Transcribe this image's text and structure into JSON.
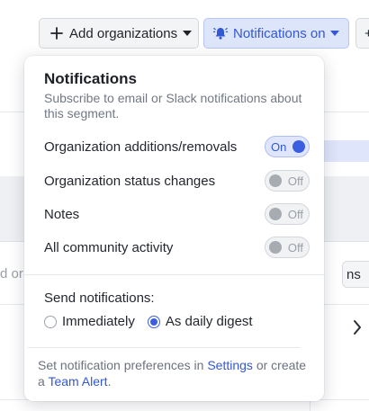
{
  "toolbar": {
    "add_label": "Add organizations",
    "notif_label": "Notifications on",
    "edge_label": "+"
  },
  "background": {
    "left_text": "d or",
    "right_btn_text": "ns"
  },
  "popover": {
    "title": "Notifications",
    "subtitle": "Subscribe to email or Slack notifications about this segment.",
    "rows": [
      {
        "label": "Organization additions/removals",
        "state": "On",
        "on": true
      },
      {
        "label": "Organization status changes",
        "state": "Off",
        "on": false
      },
      {
        "label": "Notes",
        "state": "Off",
        "on": false
      },
      {
        "label": "All community activity",
        "state": "Off",
        "on": false
      }
    ],
    "send_label": "Send notifications:",
    "options": [
      {
        "label": "Immediately",
        "checked": false
      },
      {
        "label": "As daily digest",
        "checked": true
      }
    ],
    "footer": {
      "pre": "Set notification preferences in ",
      "settings_link": "Settings",
      "mid": " or create a ",
      "team_alert_link": "Team Alert",
      "post": "."
    }
  },
  "colors": {
    "accent": "#3358d4",
    "accent_bg": "#dde5fb",
    "toggle_knob_on": "#3b5ee0",
    "toggle_knob_off": "#a7abb2"
  },
  "icons": {
    "add": "plus-icon",
    "notif": "bell-icon",
    "caret": "caret-down-icon",
    "chevron": "chevron-right-icon"
  }
}
